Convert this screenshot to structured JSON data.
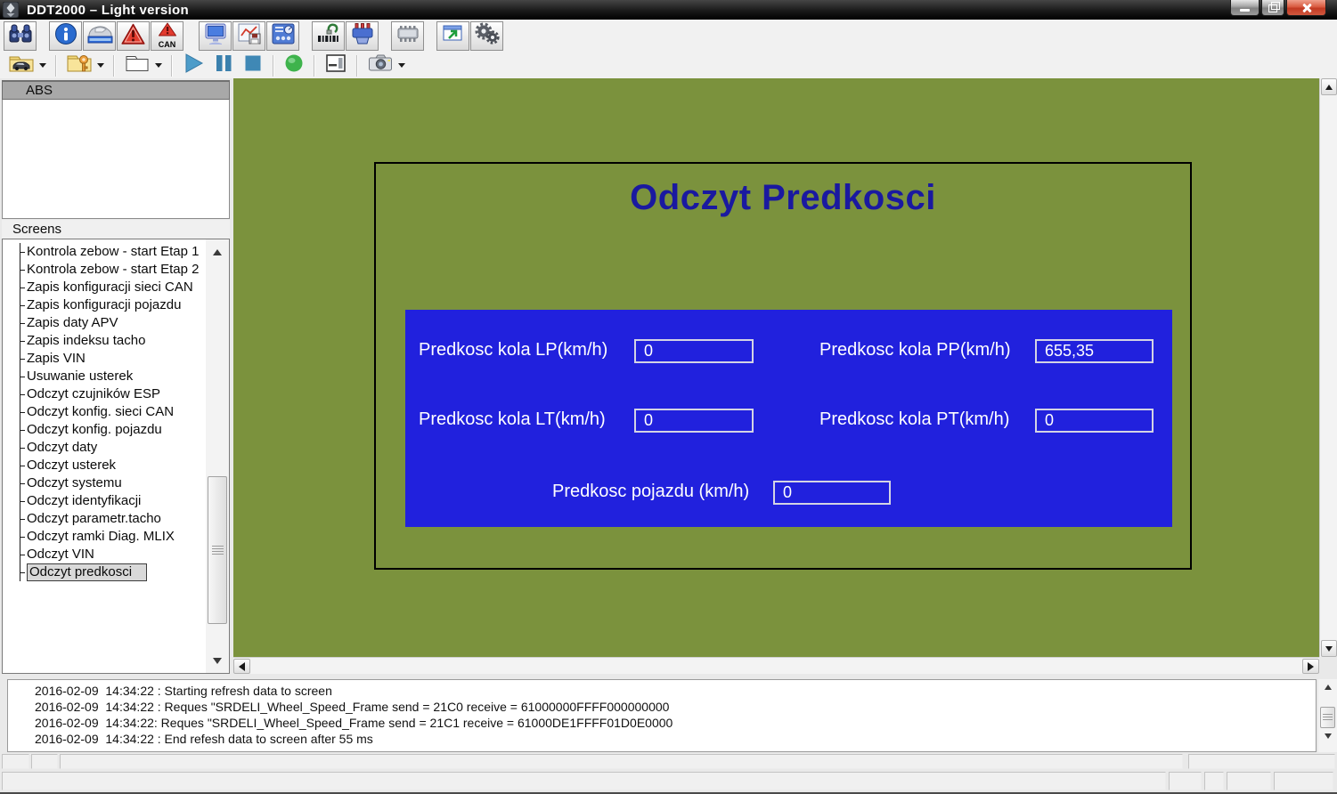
{
  "window": {
    "title": "DDT2000 – Light version"
  },
  "toolbar_main": {
    "icons": [
      "binoculars",
      "info",
      "car",
      "warning",
      "warning-can",
      "monitor",
      "screen-graph",
      "control-panel",
      "sensor",
      "connector",
      "chip",
      "window-restore",
      "gears"
    ],
    "can_label": "CAN"
  },
  "toolbar_file": {
    "icons": [
      "folder-car",
      "folder-key",
      "folder",
      "play",
      "pause",
      "stop",
      "record",
      "form",
      "camera"
    ]
  },
  "sidebar": {
    "system_header": "ABS",
    "screens_label": "Screens",
    "screens": [
      "Kontrola zebow - start Etap 1",
      "Kontrola zebow - start Etap 2",
      "Zapis konfiguracji sieci CAN",
      "Zapis konfiguracji pojazdu",
      "Zapis daty APV",
      "Zapis indeksu tacho",
      "Zapis VIN",
      "Usuwanie usterek",
      "Odczyt czujników ESP",
      "Odczyt konfig. sieci CAN",
      "Odczyt konfig. pojazdu",
      "Odczyt daty",
      "Odczyt usterek",
      "Odczyt systemu",
      "Odczyt identyfikacji",
      "Odczyt parametr.tacho",
      "Odczyt ramki Diag. MLIX",
      "Odczyt VIN",
      "Odczyt predkosci"
    ],
    "selected_screen": "Odczyt predkosci"
  },
  "main": {
    "title": "Odczyt Predkosci",
    "fields": {
      "lp": {
        "label": "Predkosc kola LP(km/h)",
        "value": "0"
      },
      "pp": {
        "label": "Predkosc kola PP(km/h)",
        "value": "655,35"
      },
      "lt": {
        "label": "Predkosc kola LT(km/h)",
        "value": "0"
      },
      "pt": {
        "label": "Predkosc kola PT(km/h)",
        "value": "0"
      },
      "vehicle": {
        "label": "Predkosc pojazdu (km/h)",
        "value": "0"
      }
    },
    "colors": {
      "background": "#7b923d",
      "panel_blue": "#2121dd",
      "title_text": "#1a19a0",
      "field_text": "#ffffff"
    }
  },
  "log": {
    "lines": [
      "2016-02-09  14:34:22 : Starting refresh data to screen",
      "2016-02-09  14:34:22 : Reques \"SRDELI_Wheel_Speed_Frame send = 21C0 receive = 61000000FFFF000000000",
      "2016-02-09  14:34:22: Reques \"SRDELI_Wheel_Speed_Frame send = 21C1 receive = 61000DE1FFFF01D0E0000",
      "2016-02-09  14:34:22 : End refesh data to screen after 55 ms"
    ]
  }
}
